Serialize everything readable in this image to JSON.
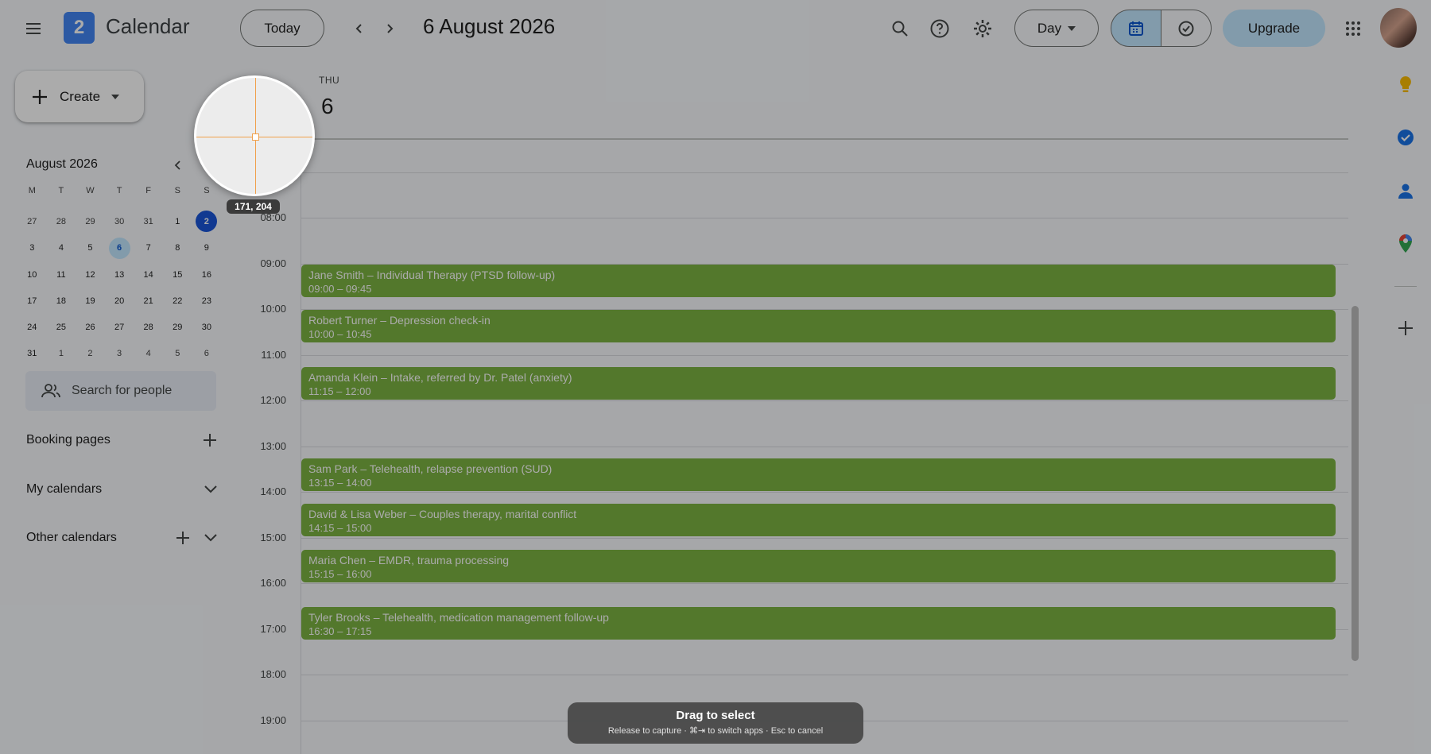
{
  "header": {
    "logo_day": "2",
    "app_title": "Calendar",
    "today_label": "Today",
    "current_date": "6 August 2026",
    "view_label": "Day",
    "upgrade_label": "Upgrade"
  },
  "sidebar": {
    "create_label": "Create",
    "mini_calendar": {
      "month_label": "August 2026",
      "weekdays": [
        "M",
        "T",
        "W",
        "T",
        "F",
        "S",
        "S"
      ],
      "weeks": [
        [
          "27",
          "28",
          "29",
          "30",
          "31",
          "1",
          "2"
        ],
        [
          "3",
          "4",
          "5",
          "6",
          "7",
          "8",
          "9"
        ],
        [
          "10",
          "11",
          "12",
          "13",
          "14",
          "15",
          "16"
        ],
        [
          "17",
          "18",
          "19",
          "20",
          "21",
          "22",
          "23"
        ],
        [
          "24",
          "25",
          "26",
          "27",
          "28",
          "29",
          "30"
        ],
        [
          "31",
          "1",
          "2",
          "3",
          "4",
          "5",
          "6"
        ]
      ],
      "today": "2",
      "selected": "6"
    },
    "search_people_placeholder": "Search for people",
    "booking_pages_label": "Booking pages",
    "my_calendars_label": "My calendars",
    "other_calendars_label": "Other calendars"
  },
  "day_view": {
    "weekday": "THU",
    "day_number": "6",
    "time_labels": [
      "08:00",
      "09:00",
      "10:00",
      "11:00",
      "12:00",
      "13:00",
      "14:00",
      "15:00",
      "16:00",
      "17:00",
      "18:00",
      "19:00"
    ],
    "event_color": "#7cb342",
    "events": [
      {
        "title": "Jane Smith – Individual Therapy (PTSD follow-up)",
        "time": "09:00 – 09:45"
      },
      {
        "title": "Robert Turner – Depression check-in",
        "time": "10:00 – 10:45"
      },
      {
        "title": "Amanda Klein – Intake, referred by Dr. Patel (anxiety)",
        "time": "11:15 – 12:00"
      },
      {
        "title": "Sam Park – Telehealth, relapse prevention (SUD)",
        "time": "13:15 – 14:00"
      },
      {
        "title": "David & Lisa Weber – Couples therapy, marital conflict",
        "time": "14:15 – 15:00"
      },
      {
        "title": "Maria Chen – EMDR, trauma processing",
        "time": "15:15 – 16:00"
      },
      {
        "title": "Tyler Brooks – Telehealth, medication management follow-up",
        "time": "16:30 – 17:15"
      }
    ]
  },
  "overlay": {
    "coordinates": "171, 204",
    "hint_title": "Drag to select",
    "hint_subtitle": "Release to capture · ⌘⇥ to switch apps · Esc to cancel"
  }
}
